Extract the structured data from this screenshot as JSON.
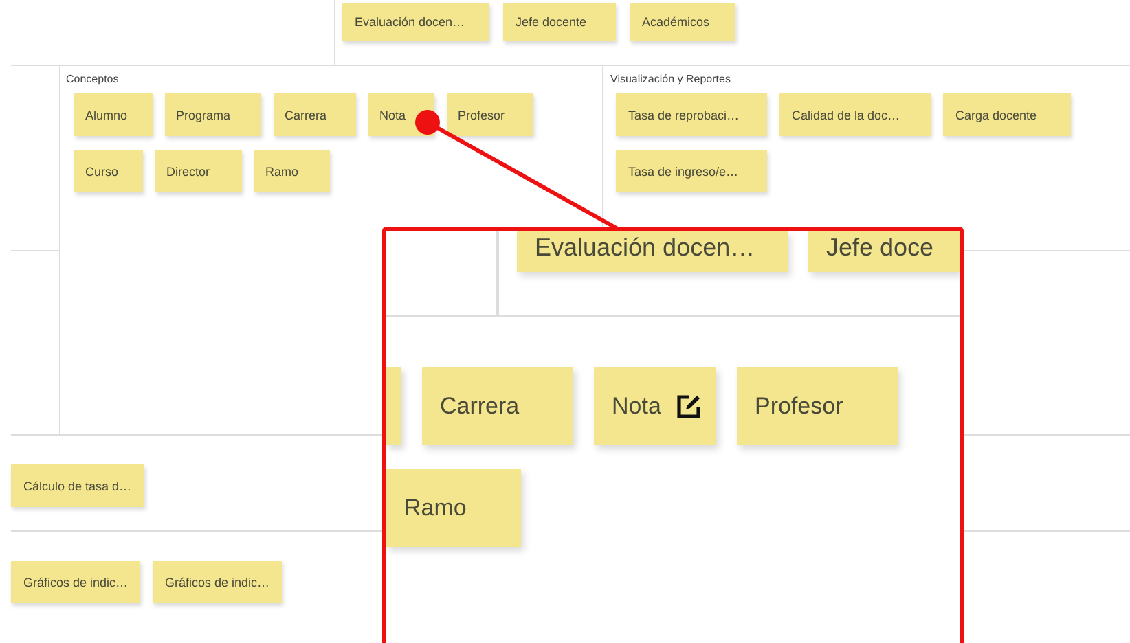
{
  "top_row": {
    "notes": [
      "Evaluación docen…",
      "Jefe docente",
      "Académicos"
    ]
  },
  "sections": [
    {
      "title": "Conceptos",
      "notes": [
        "Alumno",
        "Programa",
        "Carrera",
        "Nota",
        "Profesor",
        "Curso",
        "Director",
        "Ramo"
      ]
    },
    {
      "title": "Visualización y Reportes",
      "notes": [
        "Tasa de reprobaci…",
        "Calidad de la doc…",
        "Carga docente",
        "Tasa de ingreso/e…"
      ]
    }
  ],
  "lower_rows": [
    {
      "notes": [
        "Cálculo de tasa d…"
      ]
    },
    {
      "notes": [
        "Gráficos de indic…",
        "Gráficos de indic…"
      ]
    }
  ],
  "magnifier": {
    "top_notes": [
      "Evaluación docen…",
      "Jefe doce"
    ],
    "rows": [
      [
        {
          "kind": "partial"
        },
        {
          "kind": "note",
          "label": "Carrera",
          "hovered": false
        },
        {
          "kind": "note",
          "label": "Nota",
          "hovered": true
        },
        {
          "kind": "note",
          "label": "Profesor",
          "hovered": false
        }
      ],
      [
        {
          "kind": "note",
          "label": "Ramo",
          "hovered": false
        }
      ]
    ]
  }
}
